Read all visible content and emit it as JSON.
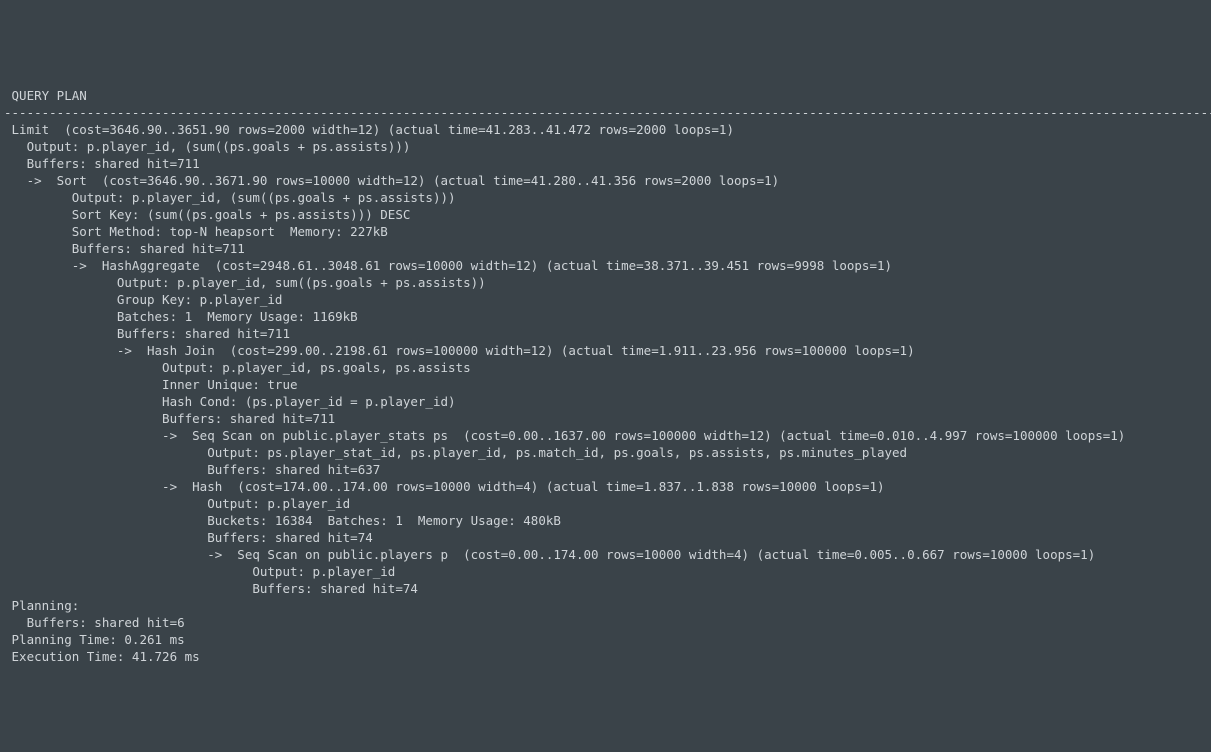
{
  "header": " QUERY PLAN                                                                                                                                                              |",
  "divider": "-------------------------------------------------------------------------------------------------------------------------------------------------------------------------+",
  "lines": [
    " Limit  (cost=3646.90..3651.90 rows=2000 width=12) (actual time=41.283..41.472 rows=2000 loops=1)                                                                        |",
    "   Output: p.player_id, (sum((ps.goals + ps.assists)))                                                                                                                   |",
    "   Buffers: shared hit=711                                                                                                                                               |",
    "   ->  Sort  (cost=3646.90..3671.90 rows=10000 width=12) (actual time=41.280..41.356 rows=2000 loops=1)                                                                  |",
    "         Output: p.player_id, (sum((ps.goals + ps.assists)))                                                                                                             |",
    "         Sort Key: (sum((ps.goals + ps.assists))) DESC                                                                                                                   |",
    "         Sort Method: top-N heapsort  Memory: 227kB                                                                                                                      |",
    "         Buffers: shared hit=711                                                                                                                                         |",
    "         ->  HashAggregate  (cost=2948.61..3048.61 rows=10000 width=12) (actual time=38.371..39.451 rows=9998 loops=1)                                                   |",
    "               Output: p.player_id, sum((ps.goals + ps.assists))                                                                                                         |",
    "               Group Key: p.player_id                                                                                                                                    |",
    "               Batches: 1  Memory Usage: 1169kB                                                                                                                          |",
    "               Buffers: shared hit=711                                                                                                                                   |",
    "               ->  Hash Join  (cost=299.00..2198.61 rows=100000 width=12) (actual time=1.911..23.956 rows=100000 loops=1)                                                |",
    "                     Output: p.player_id, ps.goals, ps.assists                                                                                                           |",
    "                     Inner Unique: true                                                                                                                                  |",
    "                     Hash Cond: (ps.player_id = p.player_id)                                                                                                             |",
    "                     Buffers: shared hit=711                                                                                                                             |",
    "                     ->  Seq Scan on public.player_stats ps  (cost=0.00..1637.00 rows=100000 width=12) (actual time=0.010..4.997 rows=100000 loops=1)                    |",
    "                           Output: ps.player_stat_id, ps.player_id, ps.match_id, ps.goals, ps.assists, ps.minutes_played                                                 |",
    "                           Buffers: shared hit=637                                                                                                                       |",
    "                     ->  Hash  (cost=174.00..174.00 rows=10000 width=4) (actual time=1.837..1.838 rows=10000 loops=1)                                                    |",
    "                           Output: p.player_id                                                                                                                           |",
    "                           Buckets: 16384  Batches: 1  Memory Usage: 480kB                                                                                               |",
    "                           Buffers: shared hit=74                                                                                                                        |",
    "                           ->  Seq Scan on public.players p  (cost=0.00..174.00 rows=10000 width=4) (actual time=0.005..0.667 rows=10000 loops=1)                        |",
    "                                 Output: p.player_id                                                                                                                     |",
    "                                 Buffers: shared hit=74                                                                                                                  |",
    " Planning:                                                                                                                                                               |",
    "   Buffers: shared hit=6                                                                                                                                                 |",
    " Planning Time: 0.261 ms                                                                                                                                                 |",
    " Execution Time: 41.726 ms                                                                                                                                               |"
  ]
}
